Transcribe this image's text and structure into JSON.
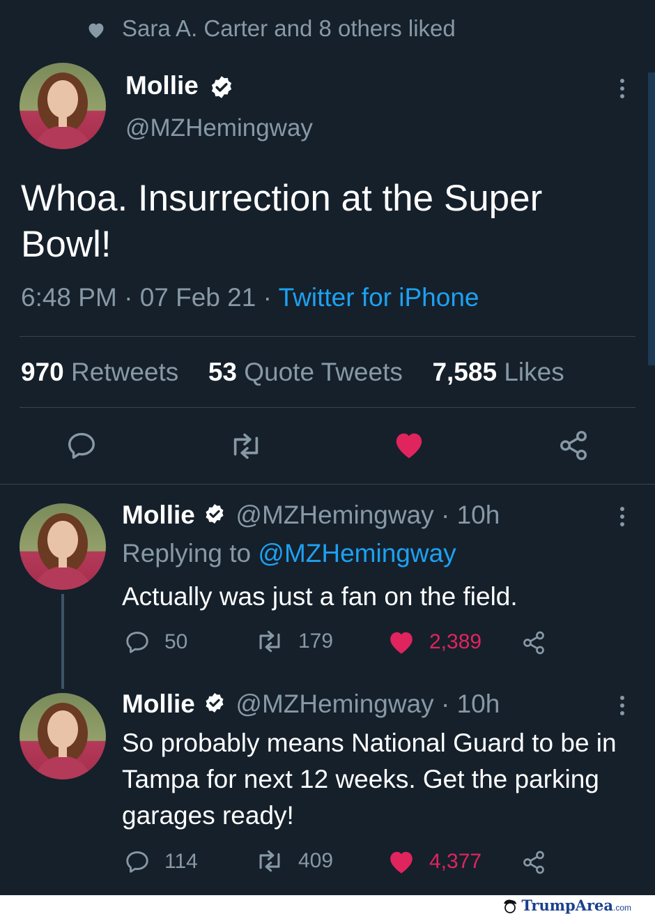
{
  "social_context": {
    "text": "Sara A. Carter and 8 others liked",
    "icon": "heart-icon"
  },
  "main_tweet": {
    "display_name": "Mollie",
    "handle": "@MZHemingway",
    "text": "Whoa. Insurrection at the Super Bowl!",
    "time": "6:48 PM",
    "date": "07 Feb 21",
    "source": "Twitter for iPhone",
    "separator": "·",
    "stats": {
      "retweets_count": "970",
      "retweets_label": "Retweets",
      "quotes_count": "53",
      "quotes_label": "Quote Tweets",
      "likes_count": "7,585",
      "likes_label": "Likes"
    },
    "actions": [
      "reply-icon",
      "retweet-icon",
      "like-icon",
      "share-icon"
    ]
  },
  "replies": [
    {
      "display_name": "Mollie",
      "handle": "@MZHemingway",
      "time": "· 10h",
      "replying_label": "Replying to",
      "replying_to": "@MZHemingway",
      "text": "Actually was just a fan on the field.",
      "replies": "50",
      "retweets": "179",
      "likes": "2,389"
    },
    {
      "display_name": "Mollie",
      "handle": "@MZHemingway",
      "time": "· 10h",
      "text": "So probably means National Guard to be in Tampa for next 12 weeks. Get the parking garages ready!",
      "replies": "114",
      "retweets": "409",
      "likes": "4,377"
    }
  ],
  "watermark": {
    "text": "TrumpArea",
    "suffix": ".com"
  },
  "colors": {
    "background": "#15202b",
    "accent": "#1da1f2",
    "like": "#e0245e",
    "muted": "#8899a6",
    "divider": "#38444d"
  }
}
